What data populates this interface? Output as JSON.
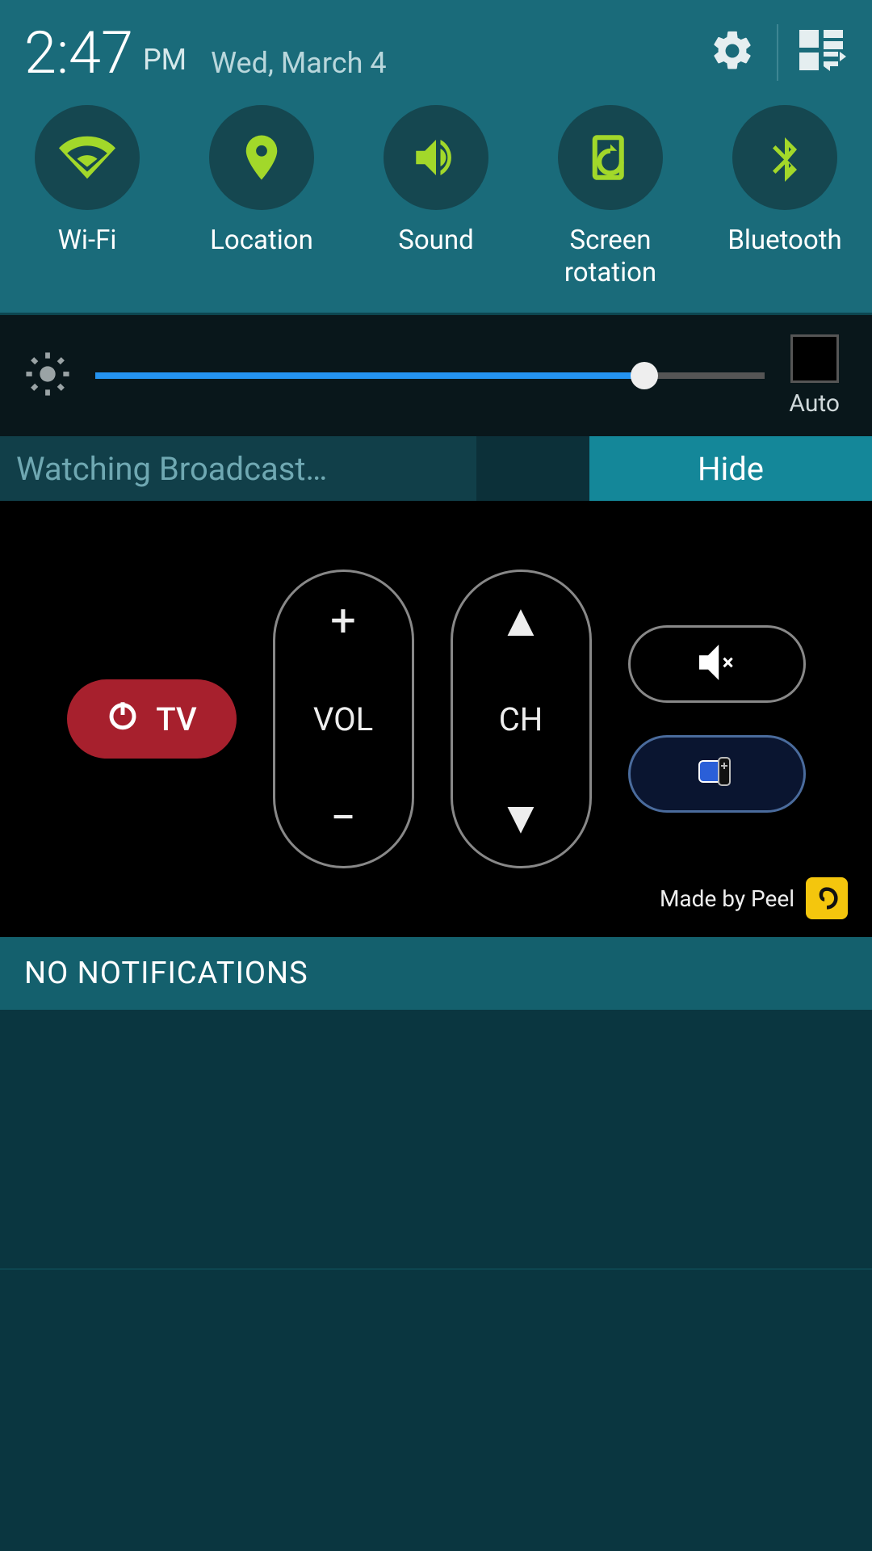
{
  "header": {
    "time": "2:47",
    "ampm": "PM",
    "date": "Wed, March 4"
  },
  "toggles": [
    {
      "id": "wifi",
      "label": "Wi-Fi"
    },
    {
      "id": "location",
      "label": "Location"
    },
    {
      "id": "sound",
      "label": "Sound"
    },
    {
      "id": "screenrotation",
      "label": "Screen\nrotation"
    },
    {
      "id": "bluetooth",
      "label": "Bluetooth"
    }
  ],
  "brightness": {
    "percent": 82,
    "auto_label": "Auto",
    "auto_checked": false
  },
  "watching": {
    "text": "Watching Broadcast…",
    "hide_label": "Hide"
  },
  "remote": {
    "tv_label": "TV",
    "vol_label": "VOL",
    "ch_label": "CH",
    "made_by": "Made by Peel"
  },
  "notifications": {
    "header": "NO NOTIFICATIONS"
  },
  "colors": {
    "accent": "#a2d82a",
    "teal": "#1a6b7a",
    "dark": "#000000"
  }
}
